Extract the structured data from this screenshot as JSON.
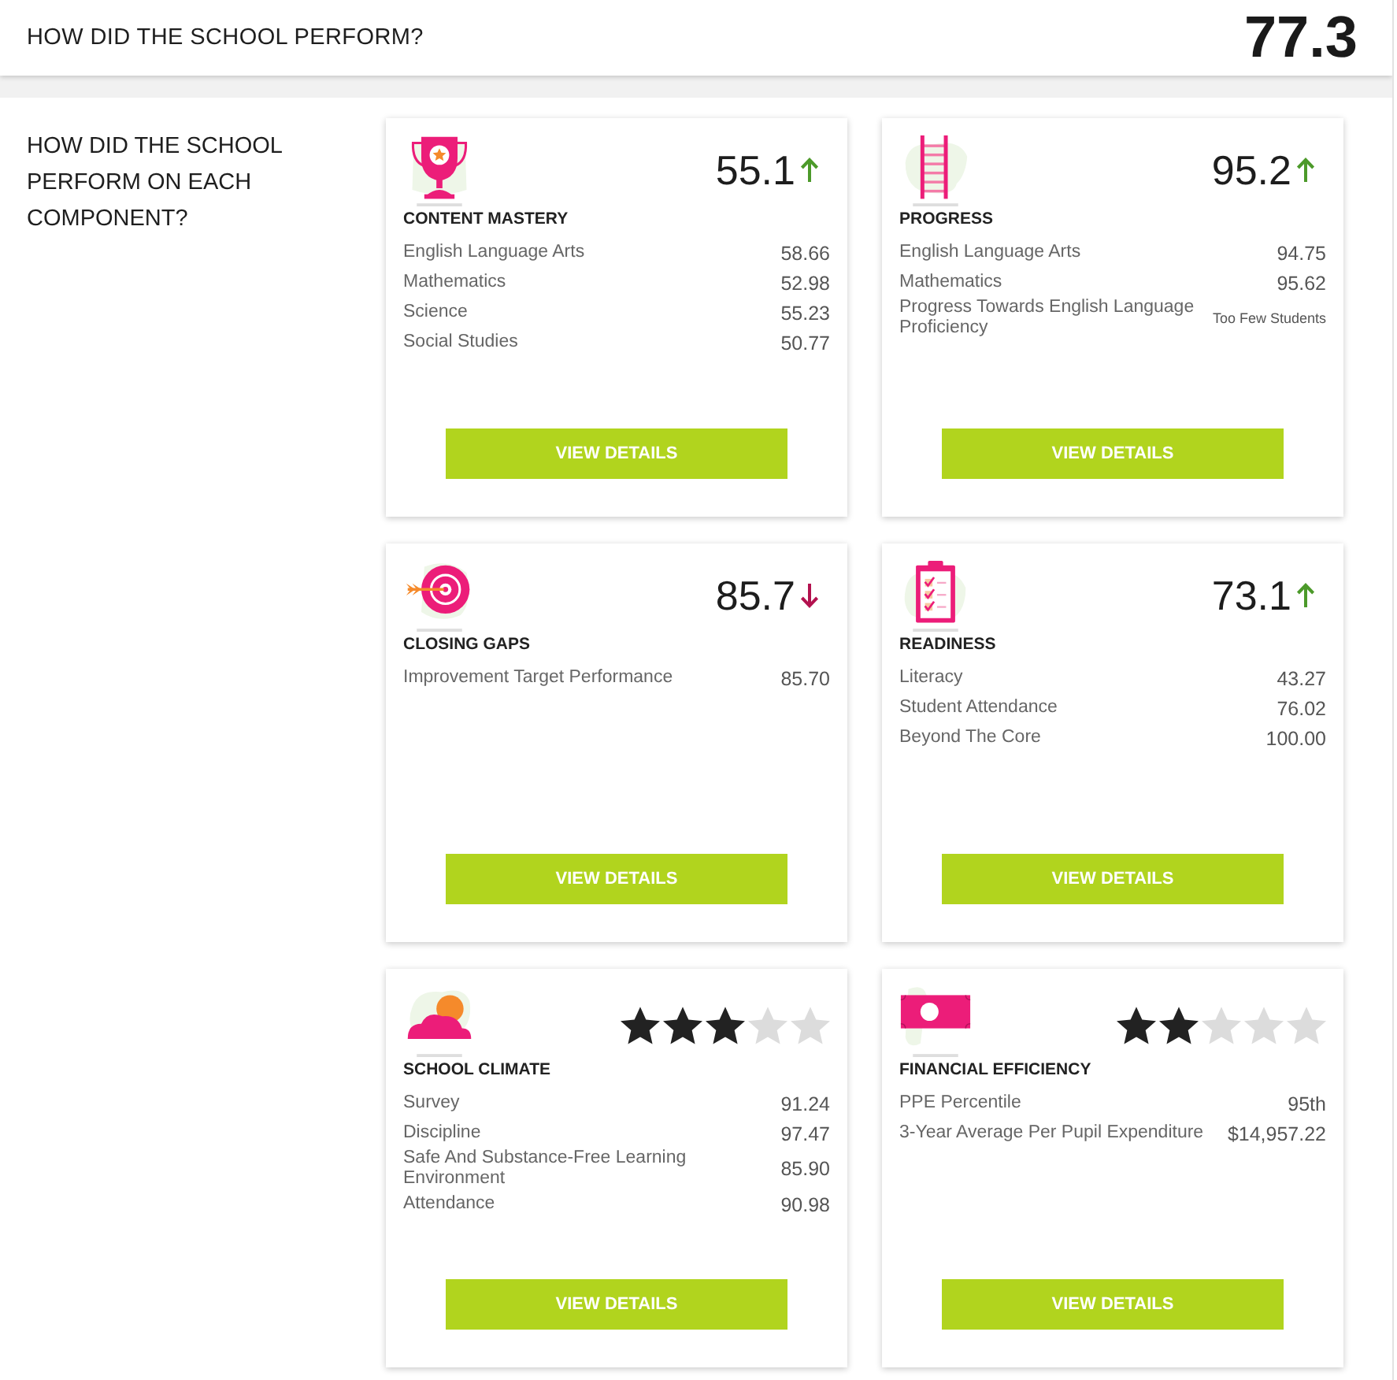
{
  "header": {
    "title": "HOW DID THE SCHOOL PERFORM?",
    "score": "77.3"
  },
  "section": {
    "heading": "HOW DID THE SCHOOL PERFORM ON EACH COMPONENT?"
  },
  "components": [
    {
      "kind": "score",
      "title": "CONTENT MASTERY",
      "score": "55.1",
      "improved": true,
      "metrics": [
        {
          "kind": "number",
          "label": "English Language Arts",
          "value": "58.66"
        },
        {
          "kind": "number",
          "label": "Mathematics",
          "value": "52.98"
        },
        {
          "kind": "number",
          "label": "Science",
          "value": "55.23"
        },
        {
          "kind": "number",
          "label": "Social Studies",
          "value": "50.77"
        }
      ],
      "button": "VIEW DETAILS"
    },
    {
      "kind": "score",
      "title": "PROGRESS",
      "score": "95.2",
      "improved": true,
      "metrics": [
        {
          "kind": "number",
          "label": "English Language Arts",
          "value": "94.75"
        },
        {
          "kind": "number",
          "label": "Mathematics",
          "value": "95.62"
        },
        {
          "kind": "note",
          "label": "Progress Towards English Language Proficiency",
          "value": "Too Few Students"
        }
      ],
      "button": "VIEW DETAILS"
    },
    {
      "kind": "score",
      "title": "CLOSING GAPS",
      "score": "85.7",
      "improved": false,
      "metrics": [
        {
          "kind": "number",
          "label": "Improvement Target Performance",
          "value": "85.70"
        }
      ],
      "button": "VIEW DETAILS"
    },
    {
      "kind": "score",
      "title": "READINESS",
      "score": "73.1",
      "improved": true,
      "metrics": [
        {
          "kind": "number",
          "label": "Literacy",
          "value": "43.27"
        },
        {
          "kind": "number",
          "label": "Student Attendance",
          "value": "76.02"
        },
        {
          "kind": "number",
          "label": "Beyond The Core",
          "value": "100.00"
        }
      ],
      "button": "VIEW DETAILS"
    },
    {
      "kind": "rating",
      "title": "SCHOOL CLIMATE",
      "stars": 3,
      "metrics": [
        {
          "kind": "number",
          "label": "Survey",
          "value": "91.24"
        },
        {
          "kind": "number",
          "label": "Discipline",
          "value": "97.47"
        },
        {
          "kind": "number",
          "label": "Safe And Substance-Free Learning Environment",
          "value": "85.90"
        },
        {
          "kind": "number",
          "label": "Attendance",
          "value": "90.98"
        }
      ],
      "button": "VIEW DETAILS"
    },
    {
      "kind": "rating",
      "title": "FINANCIAL EFFICIENCY",
      "stars": 2,
      "metrics": [
        {
          "kind": "number",
          "label": "PPE Percentile",
          "value": "95th"
        },
        {
          "kind": "number",
          "label": "3-Year Average Per Pupil Expenditure",
          "value": "$14,957.22"
        }
      ],
      "button": "VIEW DETAILS"
    }
  ]
}
